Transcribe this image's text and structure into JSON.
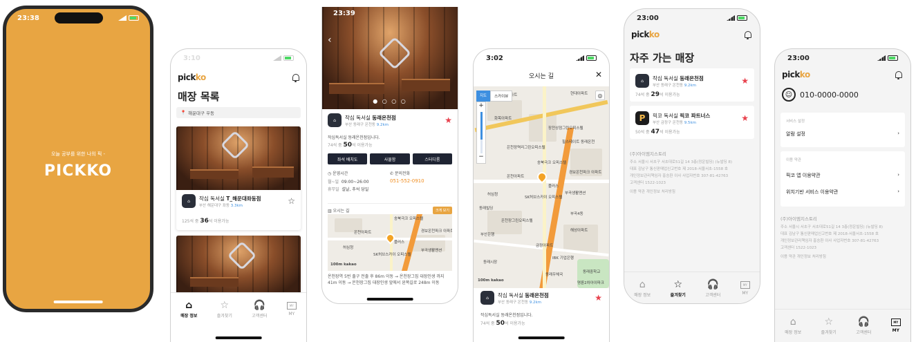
{
  "colors": {
    "splash_bg": "#E8A542",
    "accent": "#E8A542",
    "favorite": "#E8414D",
    "distance": "#3D8FE0",
    "dark_button": "#1F2433",
    "phone_number": "#F08C1E"
  },
  "splash": {
    "time": "23:38",
    "tagline": "오늘 공부를 위한 나의 픽 -",
    "logo": "PICKKO"
  },
  "list": {
    "time": "3:10",
    "logo_text": "pick",
    "logo_accent": "ko",
    "title": "매장 목록",
    "location": "해운대구 우동",
    "cards": [
      {
        "name_prefix": "작심 독서실 ",
        "name_bold": "T_해운대좌동점",
        "address": "부산 해운대구 좌동",
        "distance": "3.3km",
        "seat_pre": "125석 중 ",
        "seat_num": "36",
        "seat_post": "석 이용가능"
      }
    ],
    "tabs": [
      "매장 정보",
      "즐겨찾기",
      "고객센터",
      "MY"
    ]
  },
  "detail": {
    "time": "23:39",
    "name_prefix": "작심 독서실 ",
    "name_bold": "동래온천점",
    "address": "부산 동래구 온천동",
    "distance": "9.2km",
    "desc": "작심독서실 동래온천점입니다.",
    "seat_pre": "74석 중 ",
    "seat_num": "50",
    "seat_post": "석 이용가능",
    "buttons": [
      "좌석 배치도",
      "사물함",
      "스터디룸"
    ],
    "hours_label": "운영시간",
    "hours": [
      {
        "day": "월~일",
        "time": "09:00~26:00"
      },
      {
        "day": "휴무일",
        "time": "설날, 추석 당일"
      }
    ],
    "phone_label": "문의전화",
    "phone": "051-552-0910",
    "directions_label": "오시는 길",
    "enlarge": "크게 보기",
    "route": "온천장역 5번 출구 전출 후 86m 이동 → 온천장그집 대장인생 까지 41m 이동 → 온천장그집 대장인생 앞에서 왼쪽길로 248m 이동",
    "map_labels": [
      "송북극크 오피스텔",
      "온천아파트",
      "허심청",
      "플러스",
      "SK허브스카이 오피스텔",
      "경보온천파크 아파트",
      "부곡생활맨션"
    ],
    "scale": "100m",
    "map_brand": "kakao"
  },
  "directions": {
    "time": "3:02",
    "title": "오시는 길",
    "map_type": [
      "지도",
      "스카이뷰"
    ],
    "zoom": [
      "+",
      "−"
    ],
    "map_labels": [
      "동원아파트",
      "화목아파트",
      "현대아파트",
      "장전상점그린오피스텔",
      "은천장역리그린오피스텔",
      "힐스테이트 동래온천",
      "송북극크 오피스텔",
      "온천아파트",
      "허심청",
      "플러스",
      "경보온천파크 아파트",
      "SK허브스카이 오피스텔",
      "부곡생활맨션",
      "동래빌딩",
      "온천장그린오피스텔",
      "부산은행",
      "금정아파트",
      "IBK 기업은행",
      "부곡4동",
      "해성아파트",
      "동래우체국",
      "동래중학교",
      "명륜2차아이파크",
      "동래시장"
    ],
    "scale": "100m",
    "map_brand": "kakao",
    "card": {
      "name_prefix": "작심 독서실 ",
      "name_bold": "동래온천점",
      "address": "부산 동래구 온천동",
      "distance": "9.2km",
      "desc": "작심독서실 동래온천점입니다.",
      "seat_pre": "74석 중 ",
      "seat_num": "50",
      "seat_post": "석 이용가능"
    }
  },
  "favorites": {
    "time": "23:00",
    "logo_text": "pick",
    "logo_accent": "ko",
    "title": "자주 가는 매장",
    "items": [
      {
        "name_prefix": "작심 독서실 ",
        "name_bold": "동래온천점",
        "address": "부산 동래구 온천동",
        "distance": "9.2km",
        "seat_pre": "74석 중 ",
        "seat_num": "29",
        "seat_post": "석 이용가능",
        "icon": "jaksim"
      },
      {
        "name_prefix": "픽코 독서실 ",
        "name_bold": "픽코 파트너스",
        "address": "부산 금정구 온천동",
        "distance": "9.5km",
        "seat_pre": "50석 중 ",
        "seat_num": "47",
        "seat_post": "석 이용가능",
        "icon": "P"
      }
    ],
    "company": {
      "name": "(주)아이엠지스토리",
      "lines": [
        "주소 서울시 서초구 서초대로51길 14 3층(정운빌딩) (뉴발딩 8)",
        "대표 김남구 통신판매업신고번호 제 2018-서울서초-1558 호",
        "개인정보관리책임자 홍승환 이사 사업자번호 307-81-42763",
        "고객센터 1522-1023",
        "이용 약관  개인정보 처리방침"
      ]
    },
    "tabs": [
      "매장 정보",
      "즐겨찾기",
      "고객센터",
      "MY"
    ]
  },
  "my": {
    "time": "23:00",
    "logo_text": "pick",
    "logo_accent": "ko",
    "phone": "010-0000-0000",
    "section1_label": "서비스 설정",
    "notification": "알람 설정",
    "section2_label": "이용 약관",
    "terms": "픽코 앱 이용약관",
    "location_terms": "위치기반 서비스 이용약관",
    "company": {
      "name": "(주)아이엠지스토리",
      "lines": [
        "주소 서울시 서초구 서초대로51길 14 3층(정운빌딩) (뉴발딩 8)",
        "대표 김남구 통신판매업신고번호 제 2018-서울서초-1558 호",
        "개인정보관리책임자 홍승환 이사 사업자번호 307-81-42763",
        "고객센터 1522-1023",
        "이용 약관  개인정보 처리방침"
      ]
    },
    "tabs": [
      "매장 정보",
      "즐겨찾기",
      "고객센터",
      "MY"
    ]
  }
}
